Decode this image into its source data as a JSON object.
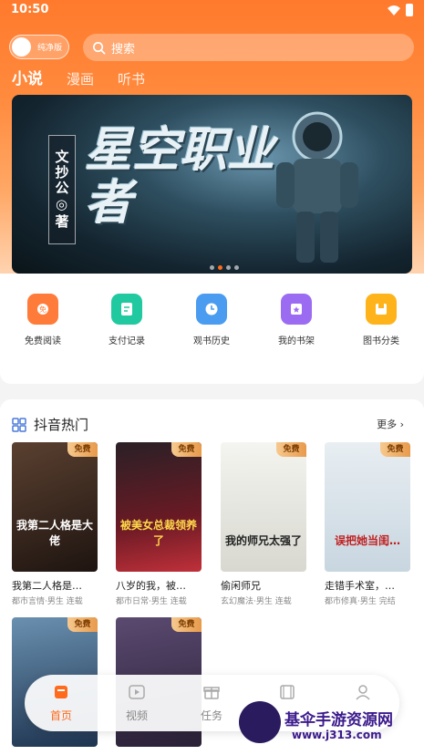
{
  "status": {
    "time": "10:50"
  },
  "header": {
    "toggle_label": "纯净版",
    "search_placeholder": "搜索",
    "tabs": [
      {
        "label": "小说",
        "active": true
      },
      {
        "label": "漫画",
        "active": false
      },
      {
        "label": "听书",
        "active": false
      }
    ]
  },
  "banner": {
    "title": "星空职业者",
    "author": "文抄公◎著",
    "slides": 4,
    "active_slide": 2
  },
  "quick_links": [
    {
      "label": "免费阅读",
      "icon": "free-read-icon",
      "color": "#ff7b3a"
    },
    {
      "label": "支付记录",
      "icon": "payment-record-icon",
      "color": "#20c9a0"
    },
    {
      "label": "观书历史",
      "icon": "history-clock-icon",
      "color": "#4a9cf0"
    },
    {
      "label": "我的书架",
      "icon": "bookshelf-icon",
      "color": "#9b6cf2"
    },
    {
      "label": "图书分类",
      "icon": "category-icon",
      "color": "#ffb31a"
    }
  ],
  "section": {
    "title": "抖音热门",
    "more": "更多",
    "badge": "免费",
    "books": [
      {
        "title": "我第二人格是…",
        "meta": "都市言情·男生 连载",
        "cover_text": "我第二人格是大佬",
        "cover_color": "#3a2a20"
      },
      {
        "title": "八岁的我，被…",
        "meta": "都市日常·男生 连载",
        "cover_text": "被美女总裁领养了",
        "cover_color": "#5a1620"
      },
      {
        "title": "偷闲师兄",
        "meta": "玄幻魔法·男生 连载",
        "cover_text": "我的师兄太强了",
        "cover_color": "#e8e8e4"
      },
      {
        "title": "走错手术室，…",
        "meta": "都市修真·男生 完结",
        "cover_text": "误把她当闺…",
        "cover_color": "#dfe8ee"
      },
      {
        "title": "",
        "meta": "",
        "cover_text": "",
        "cover_color": "#2a4a6a"
      },
      {
        "title": "",
        "meta": "",
        "cover_text": "",
        "cover_color": "#3a3050"
      }
    ]
  },
  "nav": [
    {
      "label": "首页",
      "icon": "home-icon",
      "active": true
    },
    {
      "label": "视频",
      "icon": "video-icon",
      "active": false
    },
    {
      "label": "任务",
      "icon": "gift-icon",
      "active": false
    },
    {
      "label": "",
      "icon": "film-icon",
      "active": false
    },
    {
      "label": "",
      "icon": "user-icon",
      "active": false
    }
  ],
  "watermark": {
    "name": "基伞手游资源网",
    "url": "www.j313.com"
  }
}
